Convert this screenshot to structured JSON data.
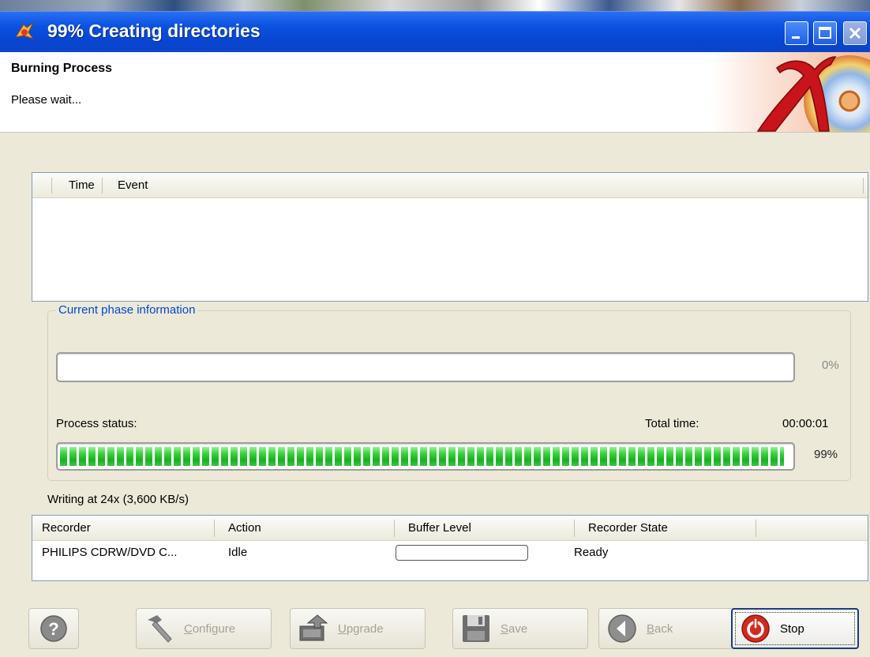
{
  "window": {
    "title": "99% Creating directories"
  },
  "header": {
    "title": "Burning Process",
    "subtitle": "Please wait..."
  },
  "log": {
    "columns": [
      "Time",
      "Event"
    ]
  },
  "phase": {
    "legend": "Current phase information",
    "phase_progress": 0,
    "phase_percent_text": "0%",
    "status_label": "Process status:",
    "total_time_label": "Total time:",
    "total_time_value": "00:00:01",
    "total_progress": 0.99,
    "total_percent_text": "99%"
  },
  "speed_text": "Writing at 24x (3,600 KB/s)",
  "recorders": {
    "columns": [
      "Recorder",
      "Action",
      "Buffer Level",
      "Recorder State"
    ],
    "rows": [
      {
        "recorder": "PHILIPS CDRW/DVD C...",
        "action": "Idle",
        "buffer_level": 0,
        "state": "Ready"
      }
    ]
  },
  "buttons": {
    "configure_first": "C",
    "configure_rest": "onfigure",
    "upgrade_first": "U",
    "upgrade_rest": "pgrade",
    "save_first": "S",
    "save_rest": "ave",
    "back_first": "B",
    "back_rest": "ack",
    "stop": "Stop"
  },
  "icons": {
    "app": "burn-app-icon",
    "logo": "x-cd-logo-icon",
    "help": "help-icon",
    "configure": "hammer-icon",
    "upgrade": "upgrade-icon",
    "save": "floppy-disk-icon",
    "back": "back-arrow-icon",
    "stop": "stop-icon"
  },
  "colors": {
    "titlebar": "#0a52e0",
    "progress_green": "#26b72f",
    "legend_blue": "#0046d5",
    "stop_red": "#d32a1e"
  }
}
